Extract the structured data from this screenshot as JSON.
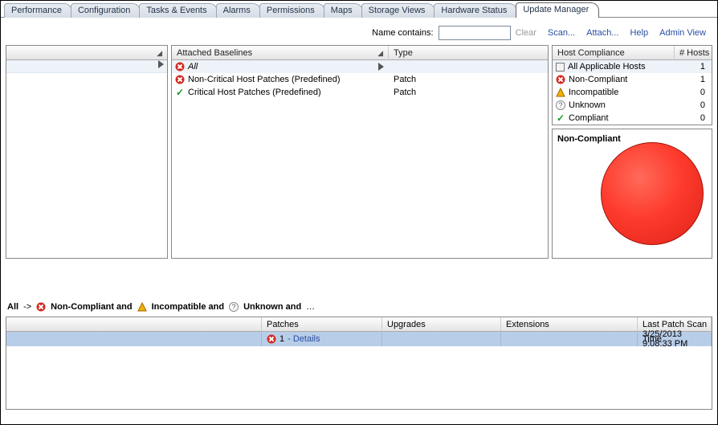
{
  "tabs": {
    "items": [
      "Performance",
      "Configuration",
      "Tasks & Events",
      "Alarms",
      "Permissions",
      "Maps",
      "Storage Views",
      "Hardware Status",
      "Update Manager"
    ],
    "active_index": 8
  },
  "toolbar": {
    "name_contains_label": "Name contains:",
    "name_contains_value": "",
    "clear": "Clear",
    "scan": "Scan...",
    "attach": "Attach...",
    "help": "Help",
    "admin_view": "Admin View"
  },
  "left_panel": {
    "header": "",
    "arrow_hint": "▶"
  },
  "baselines": {
    "header_name": "Attached Baselines",
    "header_type": "Type",
    "rows": [
      {
        "status": "error",
        "name": "All",
        "italic": true,
        "type": "",
        "selected": true,
        "arrow": true
      },
      {
        "status": "error",
        "name": "Non-Critical Host Patches (Predefined)",
        "type": "Patch"
      },
      {
        "status": "ok",
        "name": "Critical Host Patches (Predefined)",
        "type": "Patch"
      }
    ]
  },
  "compliance": {
    "header_name": "Host Compliance",
    "header_count": "# Hosts",
    "rows": [
      {
        "icon": "host",
        "label": "All Applicable Hosts",
        "count": 1,
        "selected": true
      },
      {
        "icon": "error",
        "label": "Non-Compliant",
        "count": 1
      },
      {
        "icon": "warn",
        "label": "Incompatible",
        "count": 0
      },
      {
        "icon": "unknown",
        "label": "Unknown",
        "count": 0
      },
      {
        "icon": "ok",
        "label": "Compliant",
        "count": 0
      }
    ],
    "vis_title": "Non-Compliant",
    "vis_color": "#fe3b2d"
  },
  "crumb": {
    "all": "All",
    "arrow": "->",
    "noncompliant": "Non-Compliant and",
    "incompatible": "Incompatible and",
    "unknown": "Unknown and",
    "ellipsis": "…"
  },
  "bottom": {
    "headers": {
      "blank": "",
      "patches": "Patches",
      "upgrades": "Upgrades",
      "extensions": "Extensions",
      "time": "Last Patch Scan Time"
    },
    "row": {
      "patches_count": "1",
      "patches_details": " - Details",
      "upgrades": "",
      "extensions": "",
      "time": "3/25/2013 9:08:33 PM"
    }
  }
}
